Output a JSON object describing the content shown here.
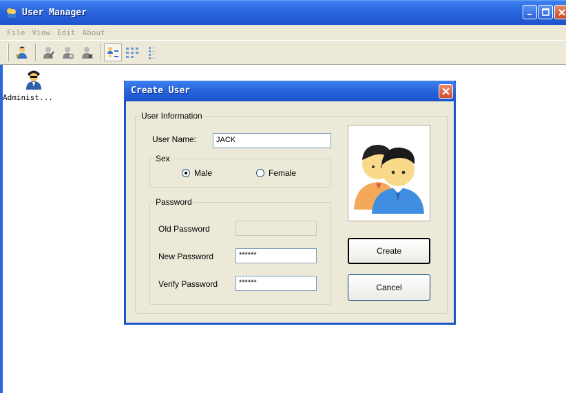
{
  "window": {
    "title": "User Manager",
    "buttons": {
      "minimize": "_",
      "maximize": "□",
      "close": "X"
    }
  },
  "menu": [
    "File",
    "View",
    "Edit",
    "About"
  ],
  "toolbar": {
    "buttons": [
      "add-user-icon",
      "edit-user-icon",
      "user-properties-icon",
      "delete-user-icon",
      "large-icons-view-icon",
      "small-icons-view-icon",
      "list-view-icon"
    ]
  },
  "users": [
    {
      "name": "Administ..."
    }
  ],
  "dialog": {
    "title": "Create User",
    "close": "×",
    "user_info_legend": "User Information",
    "user_name_label": "User Name:",
    "user_name_value": "JACK",
    "sex_legend": "Sex",
    "male_label": "Male",
    "female_label": "Female",
    "sex_selected": "Male",
    "password_legend": "Password",
    "old_password_label": "Old Password",
    "old_password_value": "",
    "new_password_label": "New Password",
    "new_password_value": "******",
    "verify_password_label": "Verify Password",
    "verify_password_value": "******",
    "create_button": "Create",
    "cancel_button": "Cancel"
  },
  "colors": {
    "titlebar": "#2a66dc",
    "dialog_bg": "#ece9d8",
    "close": "#d04a2c"
  }
}
